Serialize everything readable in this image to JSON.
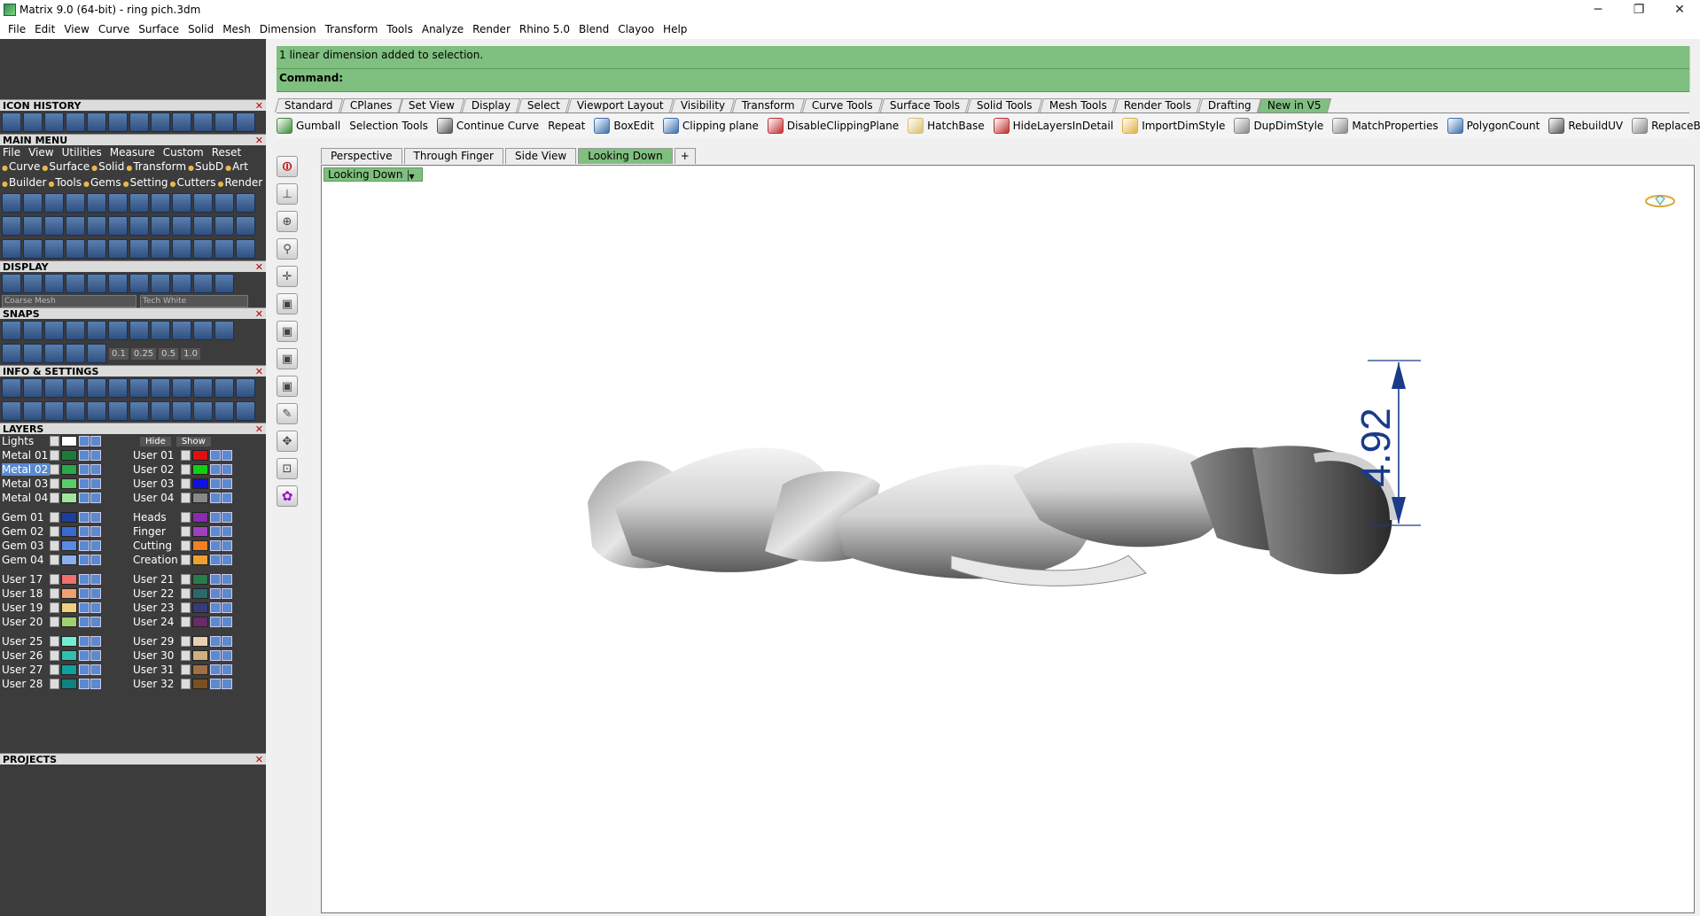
{
  "window": {
    "title": "Matrix 9.0 (64-bit) - ring pich.3dm",
    "minimize_glyph": "─",
    "restore_glyph": "❐",
    "close_glyph": "✕"
  },
  "menubar": [
    "File",
    "Edit",
    "View",
    "Curve",
    "Surface",
    "Solid",
    "Mesh",
    "Dimension",
    "Transform",
    "Tools",
    "Analyze",
    "Render",
    "Rhino 5.0",
    "Blend",
    "Clayoo",
    "Help"
  ],
  "command": {
    "history": "1 linear dimension added to selection.",
    "prompt": "Command:"
  },
  "toolbar_tabs": [
    "Standard",
    "CPlanes",
    "Set View",
    "Display",
    "Select",
    "Viewport Layout",
    "Visibility",
    "Transform",
    "Curve Tools",
    "Surface Tools",
    "Solid Tools",
    "Mesh Tools",
    "Render Tools",
    "Drafting",
    "New in V5"
  ],
  "toolbar_tabs_active": "New in V5",
  "toolbar_items": [
    {
      "label": "Gumball",
      "icon": "gumball-icon",
      "color": "#3a8a3a"
    },
    {
      "label": "Selection Tools",
      "icon": "",
      "color": ""
    },
    {
      "label": "Continue Curve",
      "icon": "curve-icon",
      "color": "#555555"
    },
    {
      "label": "Repeat",
      "icon": "",
      "color": ""
    },
    {
      "label": "BoxEdit",
      "icon": "boxedit-icon",
      "color": "#3a6fb0"
    },
    {
      "label": "Clipping plane",
      "icon": "clipping-plane-icon",
      "color": "#3a6fb0"
    },
    {
      "label": "DisableClippingPlane",
      "icon": "disable-clip-icon",
      "color": "#c03030"
    },
    {
      "label": "HatchBase",
      "icon": "hatch-icon",
      "color": "#d8c070"
    },
    {
      "label": "HideLayersInDetail",
      "icon": "hide-layers-icon",
      "color": "#c03030"
    },
    {
      "label": "ImportDimStyle",
      "icon": "import-dim-icon",
      "color": "#e0b040"
    },
    {
      "label": "DupDimStyle",
      "icon": "dup-dim-icon",
      "color": "#888888"
    },
    {
      "label": "MatchProperties",
      "icon": "match-props-icon",
      "color": "#888888"
    },
    {
      "label": "PolygonCount",
      "icon": "polygon-count-icon",
      "color": "#3a6fb0"
    },
    {
      "label": "RebuildUV",
      "icon": "rebuild-uv-icon",
      "color": "#555555"
    },
    {
      "label": "ReplaceBlock",
      "icon": "replace-block-icon",
      "color": "#888888"
    }
  ],
  "toolbar_overflow": "»",
  "viewport_tabs": [
    "Perspective",
    "Through Finger",
    "Side View",
    "Looking Down"
  ],
  "viewport_tab_active": "Looking Down",
  "viewport_tab_plus": "+",
  "viewport": {
    "name": "Looking Down",
    "dimension": "4.92",
    "dimension_color": "#1a3a8a"
  },
  "left": {
    "sections": {
      "icon_history": "ICON HISTORY",
      "main_menu": "MAIN MENU",
      "display": "DISPLAY",
      "snaps": "SNAPS",
      "info": "INFO & SETTINGS",
      "layers": "LAYERS",
      "projects": "PROJECTS"
    },
    "close_glyph": "✕",
    "main_menu_items": [
      "File",
      "View",
      "Utilities",
      "Measure",
      "Custom",
      "Reset"
    ],
    "main_menu_cats_1": [
      "Curve",
      "Surface",
      "Solid",
      "Transform",
      "SubD",
      "Art"
    ],
    "main_menu_cats_2": [
      "Builder",
      "Tools",
      "Gems",
      "Setting",
      "Cutters",
      "Render"
    ],
    "display_combo_1": "Coarse Mesh",
    "display_combo_2": "Tech White",
    "snap_values": [
      "0.1",
      "0.25",
      "0.5",
      "1.0"
    ],
    "layers_lights": "Lights",
    "layers_hide": "Hide",
    "layers_show": "Show",
    "layer_groups": [
      [
        {
          "name": "Metal 01",
          "color": "#1e7a3a",
          "sel": false,
          "r": "User 01",
          "rc": "#e01010"
        },
        {
          "name": "Metal 02",
          "color": "#2aa84a",
          "sel": true,
          "r": "User 02",
          "rc": "#10d010"
        },
        {
          "name": "Metal 03",
          "color": "#5ccc6a",
          "sel": false,
          "r": "User 03",
          "rc": "#1010e0"
        },
        {
          "name": "Metal 04",
          "color": "#9ee69a",
          "sel": false,
          "r": "User 04",
          "rc": "#888888"
        }
      ],
      [
        {
          "name": "Gem 01",
          "color": "#1a3fa0",
          "sel": false,
          "r": "Heads",
          "rc": "#8a2ab0"
        },
        {
          "name": "Gem 02",
          "color": "#3a6ad0",
          "sel": false,
          "r": "Finger",
          "rc": "#a040c0"
        },
        {
          "name": "Gem 03",
          "color": "#5a8ae8",
          "sel": false,
          "r": "Cutting",
          "rc": "#f08020"
        },
        {
          "name": "Gem 04",
          "color": "#8ab0f0",
          "sel": false,
          "r": "Creation",
          "rc": "#f0a030"
        }
      ],
      [
        {
          "name": "User 17",
          "color": "#f07070",
          "sel": false,
          "r": "User 21",
          "rc": "#2a7a4a"
        },
        {
          "name": "User 18",
          "color": "#f0a070",
          "sel": false,
          "r": "User 22",
          "rc": "#2a6a6a"
        },
        {
          "name": "User 19",
          "color": "#f0d080",
          "sel": false,
          "r": "User 23",
          "rc": "#3a3a7a"
        },
        {
          "name": "User 20",
          "color": "#a0d070",
          "sel": false,
          "r": "User 24",
          "rc": "#6a2a6a"
        }
      ],
      [
        {
          "name": "User 25",
          "color": "#70f0d0",
          "sel": false,
          "r": "User 29",
          "rc": "#e8d0b0"
        },
        {
          "name": "User 26",
          "color": "#30c0b0",
          "sel": false,
          "r": "User 30",
          "rc": "#d0b080"
        },
        {
          "name": "User 27",
          "color": "#10a0a0",
          "sel": false,
          "r": "User 31",
          "rc": "#a07040"
        },
        {
          "name": "User 28",
          "color": "#108080",
          "sel": false,
          "r": "User 32",
          "rc": "#7a5020"
        }
      ]
    ]
  }
}
